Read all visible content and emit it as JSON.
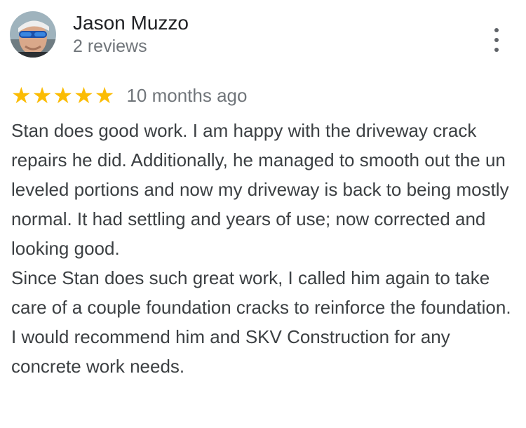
{
  "review": {
    "author_name": "Jason Muzzo",
    "review_count": "2 reviews",
    "rating": 5,
    "rating_max": 5,
    "star_color": "#fbbc04",
    "time_ago": "10 months ago",
    "menu_icon": "more-vert-icon",
    "paragraphs": [
      "Stan does good work. I am happy with the driveway crack repairs he did. Additionally, he managed to smooth out the un leveled portions and now my driveway is back to being mostly normal. It had settling and years of use; now corrected and looking good.",
      "Since Stan does such great work, I called him again to take care of a couple foundation cracks to reinforce the foundation.",
      "I would recommend him and SKV Construction for any concrete work needs."
    ]
  }
}
